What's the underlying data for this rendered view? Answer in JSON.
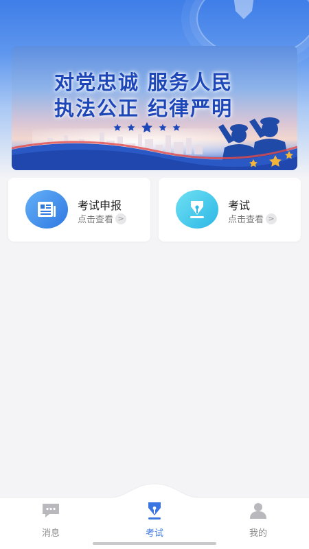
{
  "banner": {
    "line1": "对党忠诚  服务人民",
    "line2": "执法公正  纪律严明"
  },
  "cards": [
    {
      "title": "考试申报",
      "subtitle": "点击查看",
      "icon": "document-icon",
      "color": "#2f78e2"
    },
    {
      "title": "考试",
      "subtitle": "点击查看",
      "icon": "pen-nib-icon",
      "color": "#2cb7e6"
    }
  ],
  "chevron": ">",
  "tabs": [
    {
      "label": "消息",
      "icon": "chat-icon",
      "active": false
    },
    {
      "label": "考试",
      "icon": "pen-nib-icon",
      "active": true
    },
    {
      "label": "我的",
      "icon": "user-icon",
      "active": false
    }
  ],
  "colors": {
    "accent": "#3a76e2",
    "header": "#3f7ee8",
    "background": "#f4f4f6",
    "inactive": "#8c8c8c"
  }
}
